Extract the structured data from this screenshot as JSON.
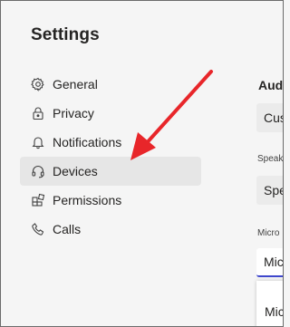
{
  "page": {
    "title": "Settings"
  },
  "nav": {
    "items": [
      {
        "id": "general",
        "label": "General",
        "icon": "gear-icon",
        "active": false
      },
      {
        "id": "privacy",
        "label": "Privacy",
        "icon": "lock-icon",
        "active": false
      },
      {
        "id": "notifications",
        "label": "Notifications",
        "icon": "bell-icon",
        "active": false
      },
      {
        "id": "devices",
        "label": "Devices",
        "icon": "headset-icon",
        "active": true
      },
      {
        "id": "permissions",
        "label": "Permissions",
        "icon": "app-grid-icon",
        "active": false
      },
      {
        "id": "calls",
        "label": "Calls",
        "icon": "phone-icon",
        "active": false
      }
    ]
  },
  "devices_panel": {
    "audio_title": "Audi",
    "audio_device_value": "Cus",
    "speaker_label": "Speak",
    "speaker_value": "Spe",
    "microphone_label": "Micro",
    "microphone_value": "Mic",
    "dropdown_option": "Mic"
  },
  "annotation": {
    "arrow_color": "#e8262a"
  },
  "colors": {
    "active_bg": "#e6e6e6",
    "focus_underline": "#3f47cc"
  }
}
